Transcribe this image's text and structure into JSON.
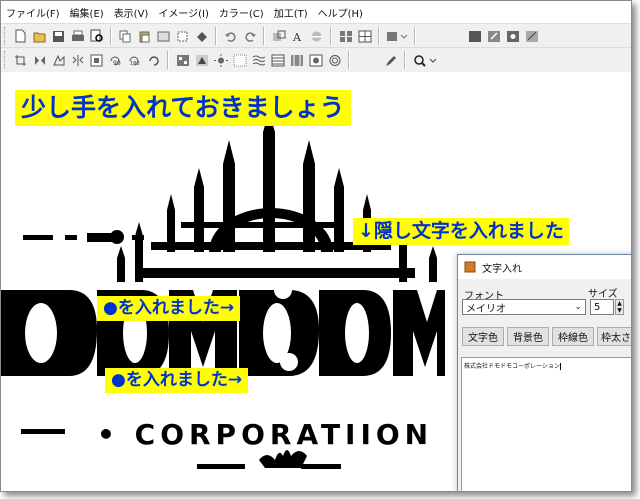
{
  "menu": [
    "ファイル(F)",
    "編集(E)",
    "表示(V)",
    "イメージ(I)",
    "カラー(C)",
    "加工(T)",
    "ヘルプ(H)"
  ],
  "toolbar_icons_1": [
    "new-icon",
    "open-icon",
    "save-icon",
    "print-icon",
    "print-preview-icon",
    "copy-icon",
    "paste-icon",
    "cut-icon",
    "crop-icon",
    "fill-icon",
    "undo-icon",
    "redo-icon",
    "resize-icon",
    "text-icon",
    "flip-icon",
    "grid-icon",
    "grid2-icon",
    "frame-icon",
    "dropper-icon",
    "zoom-icon"
  ],
  "toolbar_icons_2": [
    "crop2-icon",
    "flip-h-icon",
    "rotate-icon",
    "mirror-icon",
    "rotate90-icon",
    "rotate180-icon",
    "rotate-free-icon",
    "mosaic-icon",
    "sharpen-icon",
    "blur-icon",
    "brightness-icon",
    "pattern-icon",
    "swirl-icon",
    "spot-icon",
    "pen-icon",
    "zoom-in-icon"
  ],
  "labels": {
    "top": "少し手を入れておきましょう",
    "hidden": "↓隠し文字を入れました",
    "dot1": "●を入れました→",
    "dot2": "●を入れました→"
  },
  "logo": {
    "line1": "DOMDOM",
    "line2": "• CORPORATIION",
    "hidden_text": "株式会社ドモドモコーポレーション"
  },
  "dialog": {
    "title": "文字入れ",
    "font_label": "フォント",
    "size_label": "サイズ",
    "font_value": "メイリオ",
    "size_value": "5",
    "buttons": [
      "文字色",
      "背景色",
      "枠線色",
      "枠太さ"
    ],
    "text": "株式会社ドモドモコーポレーション"
  },
  "colors": {
    "label_bg": "#ffff00",
    "label_text": "#0033cc",
    "logo": "#000000"
  }
}
